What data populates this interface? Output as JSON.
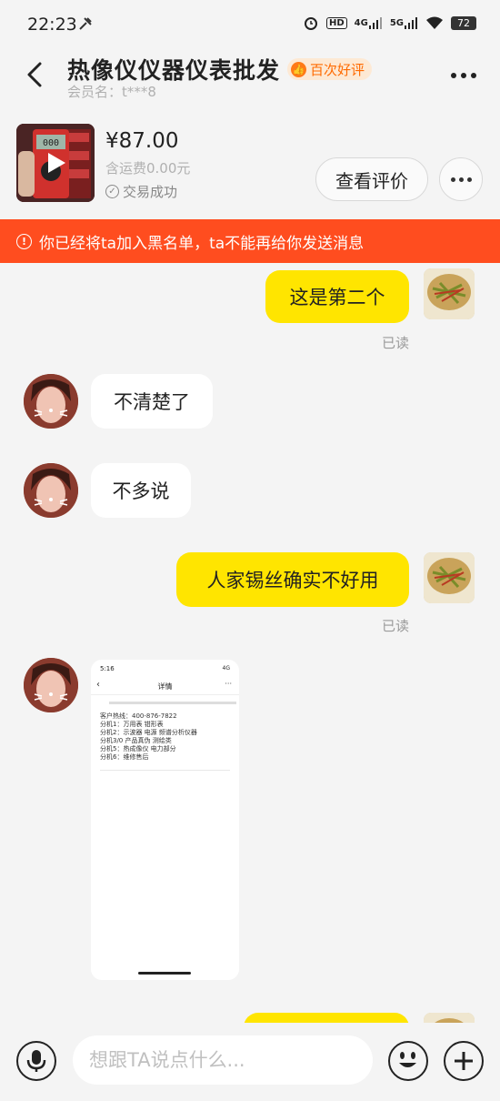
{
  "status_bar": {
    "time": "22:23",
    "battery": "72",
    "hd_label": "HD",
    "net1": "4G",
    "net2": "5G",
    "icons": [
      "tools-icon",
      "alarm-icon",
      "signal-icon",
      "wifi-icon",
      "battery-icon"
    ]
  },
  "header": {
    "title": "热像仪仪器仪表批发",
    "badge": "百次好评",
    "member": "会员名：t***8"
  },
  "product": {
    "price": "¥87.00",
    "shipping": "含运费0.00元",
    "status": "交易成功",
    "review_button": "查看评价"
  },
  "warning": {
    "text": "你已经将ta加入黑名单，ta不能再给你发送消息"
  },
  "messages": [
    {
      "side": "right",
      "text": "这是第二个",
      "read": "已读"
    },
    {
      "side": "left",
      "text": "不清楚了"
    },
    {
      "side": "left",
      "text": "不多说"
    },
    {
      "side": "right",
      "text": "人家锡丝确实不好用",
      "read": "已读"
    },
    {
      "side": "left",
      "type": "image"
    }
  ],
  "screenshot": {
    "time": "5:16",
    "net": "4G",
    "title": "详情",
    "lines": [
      "客户热线：400-876-7822",
      "分机1：万用表 钳形表",
      "分机2：示波器 电源 频谱分析仪器",
      "分机3/0 产品真伪 测绘类",
      "分机5：热成像仪 电力部分",
      "分机6：维修售后"
    ]
  },
  "input": {
    "placeholder": "想跟TA说点什么..."
  }
}
